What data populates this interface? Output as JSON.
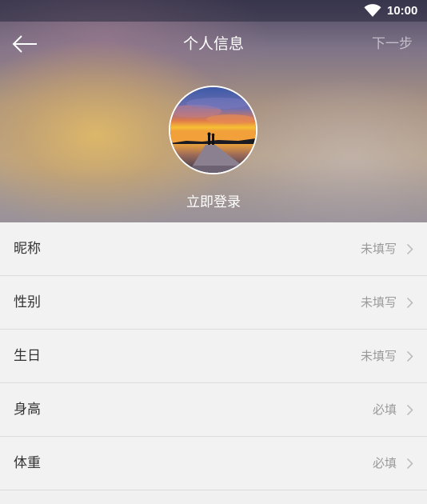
{
  "status_bar": {
    "time": "10:00",
    "wifi_icon": "wifi-icon"
  },
  "header": {
    "back_icon": "back-arrow-icon",
    "title": "个人信息",
    "next_label": "下一步",
    "avatar_icon": "avatar-landscape-image",
    "login_label": "立即登录"
  },
  "items": [
    {
      "label": "昵称",
      "value": "未填写"
    },
    {
      "label": "性别",
      "value": "未填写"
    },
    {
      "label": "生日",
      "value": "未填写"
    },
    {
      "label": "身高",
      "value": "必填"
    },
    {
      "label": "体重",
      "value": "必填"
    }
  ],
  "colors": {
    "list_background": "#f2f2f2",
    "divider": "#dcdcdc",
    "label_text": "#333333",
    "value_text": "#9a9a9a",
    "header_text": "#ffffff"
  }
}
